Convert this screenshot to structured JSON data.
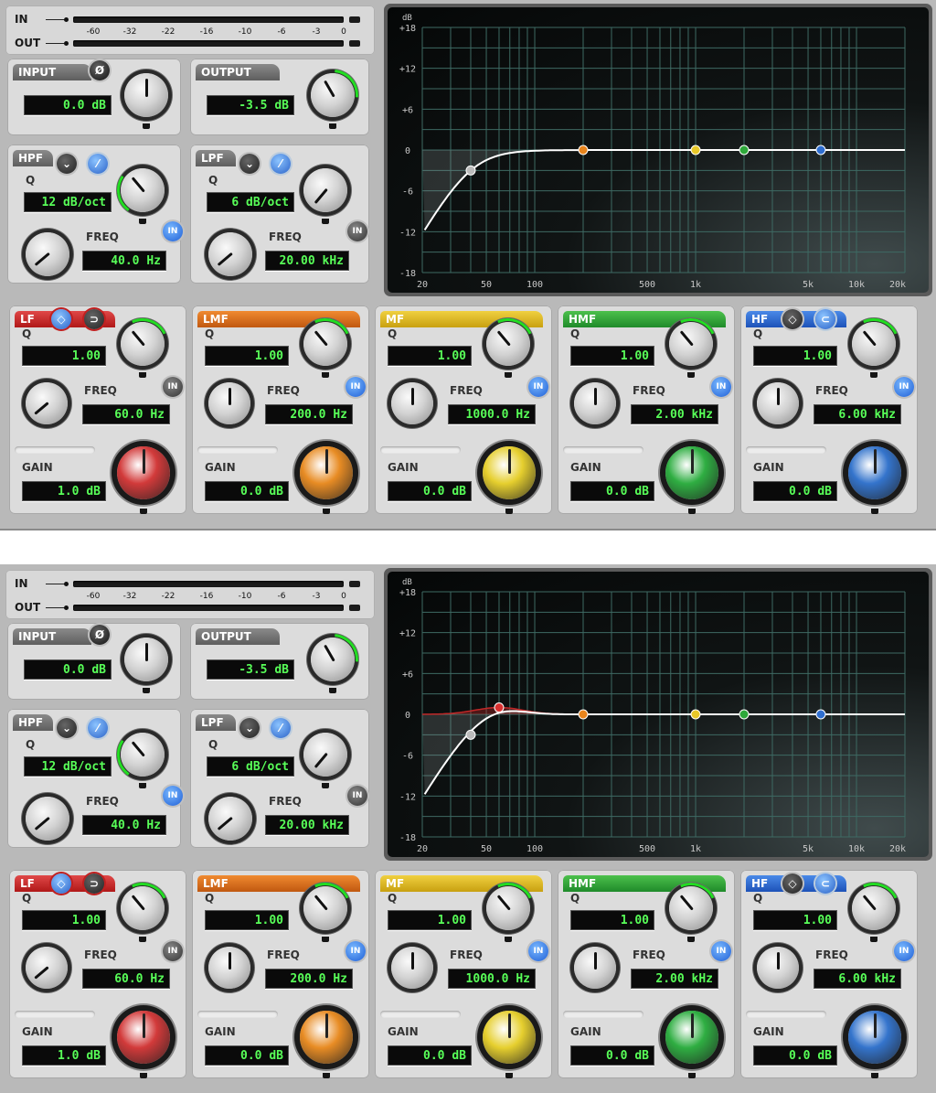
{
  "meter": {
    "in_label": "IN",
    "out_label": "OUT",
    "scale": [
      "-60",
      "-32",
      "-22",
      "-16",
      "-10",
      "-6",
      "-3",
      "0"
    ]
  },
  "input": {
    "title": "INPUT",
    "value": "0.0 dB",
    "phase_icon": "Ø"
  },
  "output": {
    "title": "OUTPUT",
    "value": "-3.5 dB"
  },
  "hpf": {
    "title": "HPF",
    "q_label": "Q",
    "q_value": "12 dB/oct",
    "freq_label": "FREQ",
    "freq_value": "40.0 Hz",
    "in_label": "IN"
  },
  "lpf": {
    "title": "LPF",
    "q_label": "Q",
    "q_value": "6 dB/oct",
    "freq_label": "FREQ",
    "freq_value": "20.00 kHz",
    "in_label": "IN"
  },
  "graph": {
    "db_label": "dB",
    "y_ticks": [
      "+18",
      "+12",
      "+6",
      "0",
      "-6",
      "-12",
      "-18"
    ],
    "x_ticks": [
      "20",
      "50",
      "100",
      "500",
      "1k",
      "5k",
      "10k",
      "20k"
    ]
  },
  "bands": [
    {
      "title": "LF",
      "q_label": "Q",
      "q_value": "1.00",
      "freq_label": "FREQ",
      "freq_value": "60.0 Hz",
      "gain_label": "GAIN",
      "gain_value": "1.0 dB",
      "in_label": "IN",
      "color": "#d83030"
    },
    {
      "title": "LMF",
      "q_label": "Q",
      "q_value": "1.00",
      "freq_label": "FREQ",
      "freq_value": "200.0 Hz",
      "gain_label": "GAIN",
      "gain_value": "0.0 dB",
      "in_label": "IN",
      "color": "#e8841c"
    },
    {
      "title": "MF",
      "q_label": "Q",
      "q_value": "1.00",
      "freq_label": "FREQ",
      "freq_value": "1000.0 Hz",
      "gain_label": "GAIN",
      "gain_value": "0.0 dB",
      "in_label": "IN",
      "color": "#e8c828"
    },
    {
      "title": "HMF",
      "q_label": "Q",
      "q_value": "1.00",
      "freq_label": "FREQ",
      "freq_value": "2.00 kHz",
      "gain_label": "GAIN",
      "gain_value": "0.0 dB",
      "in_label": "IN",
      "color": "#2ea83a"
    },
    {
      "title": "HF",
      "q_label": "Q",
      "q_value": "1.00",
      "freq_label": "FREQ",
      "freq_value": "6.00 kHz",
      "gain_label": "GAIN",
      "gain_value": "0.0 dB",
      "in_label": "IN",
      "color": "#2f6ed0"
    }
  ],
  "knob_colors": {
    "lf": "#d23a3a",
    "lmf": "#e88c24",
    "mf": "#e6cf2e",
    "hmf": "#2fae42",
    "hf": "#3474cc"
  }
}
